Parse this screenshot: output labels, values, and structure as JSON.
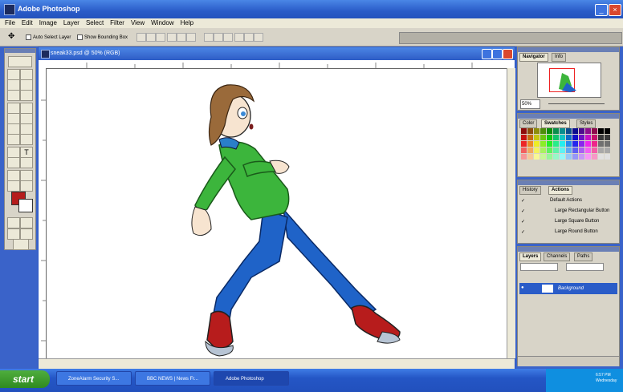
{
  "app": {
    "title": "Adobe Photoshop"
  },
  "menu": [
    "File",
    "Edit",
    "Image",
    "Layer",
    "Select",
    "Filter",
    "View",
    "Window",
    "Help"
  ],
  "options": {
    "auto_select": "Auto Select Layer",
    "bounding_box": "Show Bounding Box"
  },
  "document": {
    "title": "sneak33.psd @ 50% (RGB)"
  },
  "navigator": {
    "tabs": [
      "Navigator",
      "Info"
    ],
    "zoom": "50%"
  },
  "color_panel": {
    "tabs": [
      "Color",
      "Swatches",
      "Styles"
    ]
  },
  "history_panel": {
    "tabs": [
      "History",
      "Actions"
    ],
    "set_name": "Default Actions",
    "items": [
      "Large Rectangular Button",
      "Large Square Button",
      "Large Round Button"
    ]
  },
  "layers_panel": {
    "tabs": [
      "Layers",
      "Channels",
      "Paths"
    ],
    "layer_name": "Background"
  },
  "taskbar": {
    "start": "start",
    "items": [
      "ZoneAlarm Security S...",
      "BBC NEWS | News Fr...",
      "Adobe Photoshop"
    ],
    "time": "6:57 PM",
    "day": "Wednesday"
  },
  "colors": {
    "titlebar": "#2a5cc8",
    "foreground": "#b51c1c",
    "shirt": "#3cb53c",
    "jeans": "#1f63c8",
    "shoes": "#b71c1c",
    "hair": "#9a6a3a"
  }
}
